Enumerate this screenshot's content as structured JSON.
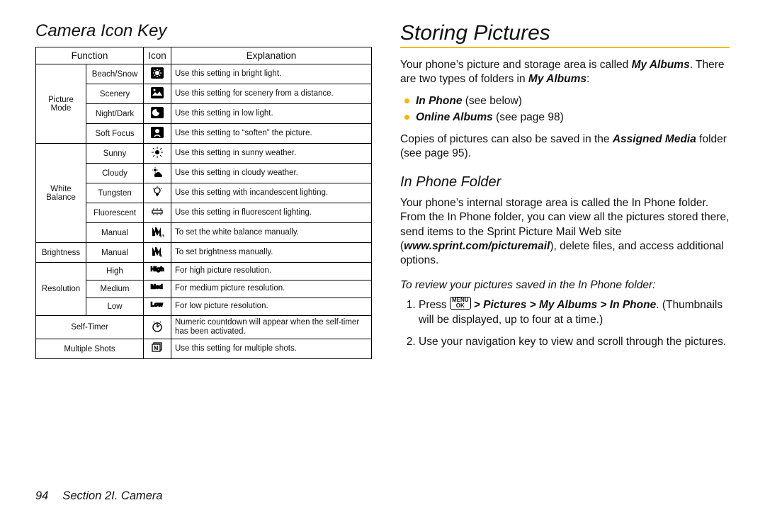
{
  "left": {
    "title": "Camera Icon Key",
    "table": {
      "headers": [
        "Function",
        "Icon",
        "Explanation"
      ],
      "groups": [
        {
          "func": "Picture Mode",
          "rows": [
            {
              "sub": "Beach/Snow",
              "exp": "Use this setting in bright light."
            },
            {
              "sub": "Scenery",
              "exp": "Use this setting for scenery from a distance."
            },
            {
              "sub": "Night/Dark",
              "exp": "Use this setting in low light."
            },
            {
              "sub": "Soft Focus",
              "exp": "Use this setting to “soften” the picture."
            }
          ]
        },
        {
          "func": "White Balance",
          "rows": [
            {
              "sub": "Sunny",
              "exp": "Use this setting in sunny weather."
            },
            {
              "sub": "Cloudy",
              "exp": "Use this setting in cloudy weather."
            },
            {
              "sub": "Tungsten",
              "exp": "Use this setting with incandescent lighting."
            },
            {
              "sub": "Fluorescent",
              "exp": "Use this setting in fluorescent lighting."
            },
            {
              "sub": "Manual",
              "exp": "To set the white balance manually."
            }
          ]
        },
        {
          "func": "Brightness",
          "rows": [
            {
              "sub": "Manual",
              "exp": "To set brightness manually."
            }
          ]
        },
        {
          "func": "Resolution",
          "rows": [
            {
              "sub": "High",
              "exp": "For high picture resolution."
            },
            {
              "sub": "Medium",
              "exp": "For medium picture resolution."
            },
            {
              "sub": "Low",
              "exp": "For low picture resolution."
            }
          ]
        },
        {
          "func": "",
          "rows": [
            {
              "sub": "Self-Timer",
              "span": true,
              "exp": "Numeric countdown will appear when the self-timer has been activated."
            }
          ]
        },
        {
          "func": "",
          "rows": [
            {
              "sub": "Multiple Shots",
              "span": true,
              "exp": "Use this setting for multiple shots."
            }
          ]
        }
      ]
    }
  },
  "right": {
    "title": "Storing Pictures",
    "intro_1a": "Your phone’s picture and storage area is called ",
    "intro_1b": "My Albums",
    "intro_1c": ". There are two types of folders in ",
    "intro_1d": "My Albums",
    "intro_1e": ":",
    "bullets": [
      {
        "label": "In Phone",
        "rest": " (see below)"
      },
      {
        "label": "Online Albums",
        "rest": " (see page 98)"
      }
    ],
    "copies_a": "Copies of pictures can also be saved in the ",
    "copies_b": "Assigned Media",
    "copies_c": " folder (see page 95).",
    "subhead": "In Phone Folder",
    "inphone_a": "Your phone’s internal storage area is called the In Phone folder. From the In Phone folder, you can view all the pictures stored there, send items to the Sprint Picture Mail Web site (",
    "inphone_url": "www.sprint.com/picturemail",
    "inphone_b": "), delete files, and access additional options.",
    "instr_head": "To review your pictures saved in the In Phone folder:",
    "step1_a": "Press ",
    "step1_key_top": "MENU",
    "step1_key_bot": "OK",
    "step1_b": " > Pictures > My Albums > In Phone",
    "step1_c": ". (Thumbnails will be displayed, up to four at a time.)",
    "step2": "Use your navigation key to view and scroll through the pictures."
  },
  "footer": {
    "page": "94",
    "section": "Section 2I. Camera"
  }
}
